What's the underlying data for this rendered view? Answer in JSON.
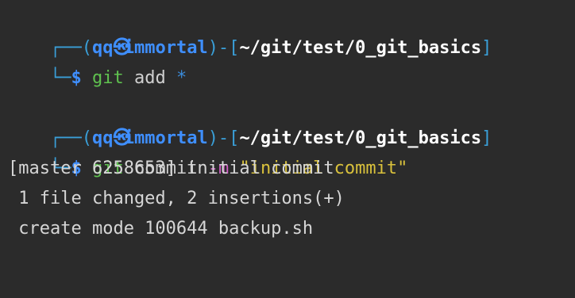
{
  "prompt": {
    "user": "qq",
    "host": "immortal",
    "path": "~/git/test/0_git_basics",
    "corner_top": "┌──",
    "corner_bottom": "└─",
    "dollar": "$",
    "skull_icon": "skull-icon"
  },
  "commands": [
    {
      "cmd": "git",
      "args": [
        {
          "text": "add",
          "style": "muted"
        },
        {
          "text": "*",
          "style": "star"
        }
      ]
    },
    {
      "cmd": "git",
      "args": [
        {
          "text": "commit",
          "style": "muted"
        },
        {
          "text": "-m",
          "style": "magenta"
        },
        {
          "text": "\"initial commit\"",
          "style": "yellow"
        }
      ]
    }
  ],
  "output": [
    "[master 6258653] initial commit",
    " 1 file changed, 2 insertions(+)",
    " create mode 100644 backup.sh"
  ],
  "colors": {
    "background": "#2b2b2b",
    "prompt_frame": "#3a9fd8",
    "user_host": "#3f8fff",
    "path": "#ffffff",
    "command": "#5fc24f",
    "string": "#d9c13c",
    "flag": "#d45fc9"
  }
}
